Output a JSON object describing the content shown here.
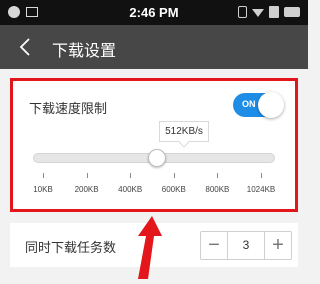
{
  "status_bar": {
    "time": "2:46 PM"
  },
  "header": {
    "title": "下载设置"
  },
  "speed_limit": {
    "label": "下载速度限制",
    "toggle_text": "ON",
    "enabled": true,
    "tooltip_value": "512KB/s",
    "slider_fraction": 0.51,
    "ticks": [
      "10KB",
      "200KB",
      "400KB",
      "600KB",
      "800KB",
      "1024KB"
    ]
  },
  "concurrent": {
    "label": "同时下载任务数",
    "value": "3",
    "minus": "−",
    "plus": "+"
  },
  "colors": {
    "highlight": "#e3161b",
    "accent": "#1e8de6",
    "titlebar": "#474747"
  }
}
